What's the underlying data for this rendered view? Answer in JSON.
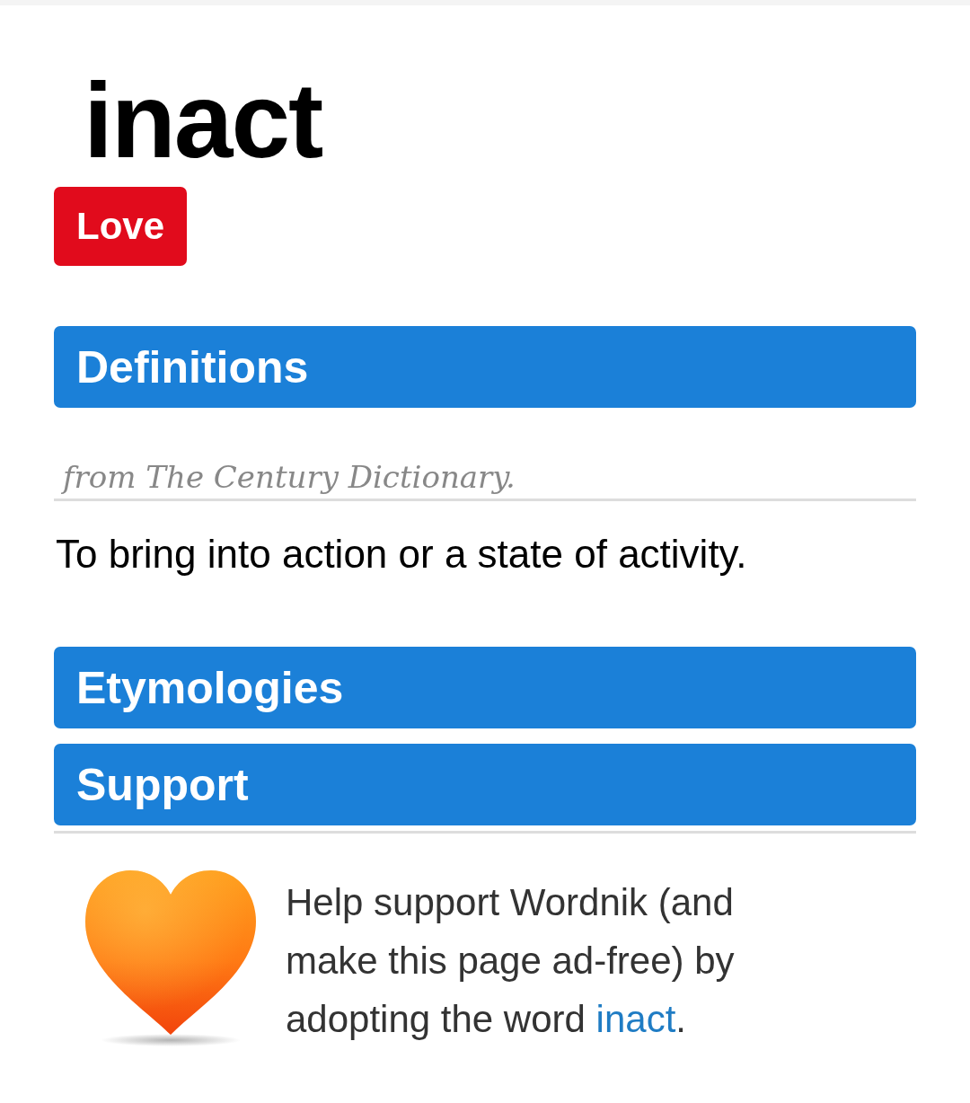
{
  "title": "inact",
  "love_button": {
    "label": "Love"
  },
  "definitions": {
    "header": "Definitions",
    "source": "from The Century Dictionary.",
    "entries": [
      "To bring into action or a state of activity."
    ]
  },
  "etymologies": {
    "header": "Etymologies"
  },
  "support": {
    "header": "Support",
    "message": {
      "text": "Help support Wordnik (and make this page ad-free) by adopting the word",
      "link": "inact",
      "end": "."
    }
  }
}
